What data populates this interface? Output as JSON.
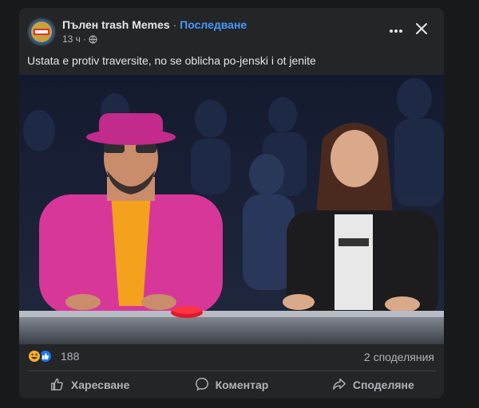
{
  "post": {
    "author": "Пълен trash Memes",
    "separator": "·",
    "follow_label": "Последване",
    "time": "13 ч",
    "meta_separator": "·",
    "caption": "Ustata e protiv traversite, no se oblicha po-jenski i ot jenite",
    "image_icon": "tv-show-photo"
  },
  "header_icons": {
    "more": "more-horizontal-icon",
    "close": "close-icon",
    "privacy": "globe-icon"
  },
  "stats": {
    "reaction_count": "188",
    "reaction_types": [
      "haha",
      "like"
    ],
    "shares_label": "2 споделяния"
  },
  "actions": {
    "like_label": "Харесване",
    "comment_label": "Коментар",
    "share_label": "Споделяне"
  },
  "colors": {
    "background": "#18191a",
    "card": "#242526",
    "accent": "#4599ff",
    "text": "#e4e6eb",
    "muted": "#b0b3b8"
  }
}
